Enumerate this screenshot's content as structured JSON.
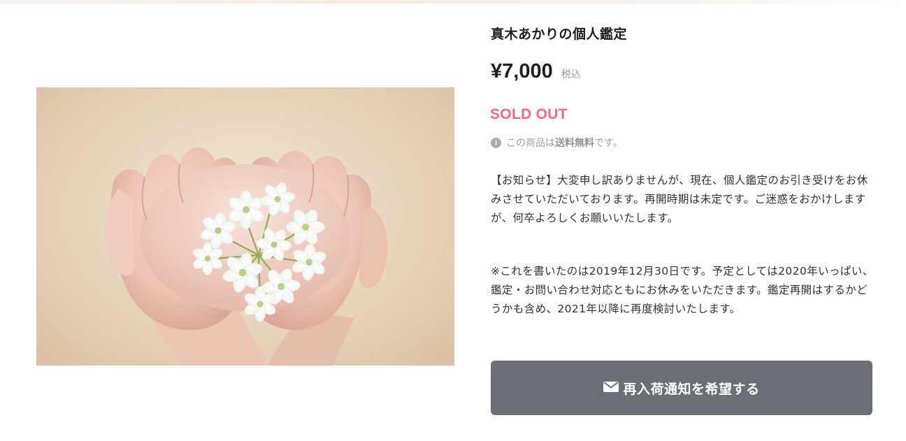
{
  "product": {
    "title": "真木あかりの個人鑑定",
    "price": "¥7,000",
    "tax_label": "税込",
    "status": "SOLD OUT",
    "shipping": {
      "prefix": "この商品は",
      "emphasis": "送料無料",
      "suffix": "です。"
    },
    "description": [
      "【お知らせ】大変申し訳ありませんが、現在、個人鑑定のお引き受けをお休みさせていただいております。再開時期は未定です。ご迷惑をおかけしますが、何卒よろしくお願いいたします。",
      "※これを書いたのは2019年12月30日です。予定としては2020年いっぱい、鑑定・お問い合わせ対応ともにお休みをいただきます。鑑定再開はするかどうかも含め、2021年以降に再度検討いたします。"
    ],
    "notify_button_label": "再入荷通知を希望する",
    "image_alt": "両手で包まれた白い花"
  },
  "icons": {
    "info": "info-icon",
    "notify": "mail-icon"
  },
  "colors": {
    "sold_out": "#ee6a83",
    "button_bg": "#6b6f75",
    "muted_text": "#9a9fa6"
  }
}
